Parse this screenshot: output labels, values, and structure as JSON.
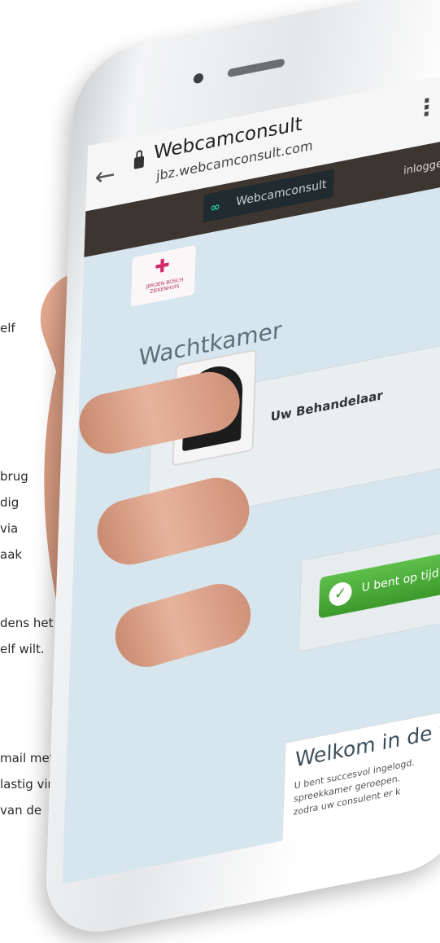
{
  "background_text": [
    "elf",
    "brug",
    "dig",
    "via",
    "aak",
    "dens het",
    "elf wilt.",
    "mail met",
    "lastig vindt",
    "van de"
  ],
  "browser": {
    "title": "Webcamconsult",
    "url": "jbz.webcamconsult.com",
    "back_icon": "arrow-left-icon",
    "menu_icon": "more-vertical-icon"
  },
  "site": {
    "brand_name": "Webcamconsult",
    "login_link": "inloggen",
    "hospital_logo_text": "JEROEN BOSCH ZIEKENHUIS",
    "waiting_room_heading": "Wachtkamer",
    "provider_name": "Uw Behandelaar",
    "status_button": "U bent op tijd",
    "welcome_title": "Welkom in de wa",
    "welcome_lines": [
      "U bent succesvol ingelogd.",
      "spreekkamer geroepen. ",
      "zodra uw consulent er k"
    ]
  },
  "colors": {
    "header": "#3d3530",
    "button_green": "#4cad3b",
    "accent_pink": "#d6286b"
  }
}
